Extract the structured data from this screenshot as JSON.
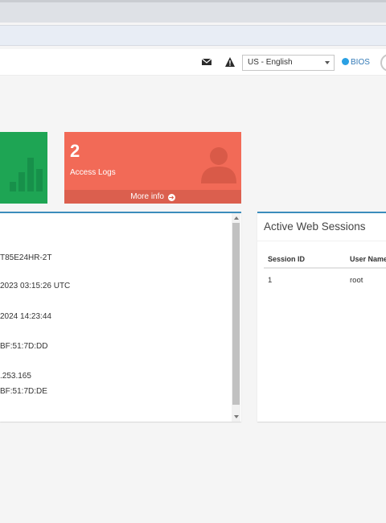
{
  "header": {
    "language_select": {
      "value": "US - English"
    },
    "bios_link": "BIOS",
    "icons": [
      "envelope-icon",
      "warning-icon",
      "globe-icon"
    ]
  },
  "tiles": {
    "green": {
      "icon": "bar-chart-icon",
      "color": "#1ea554"
    },
    "access_logs": {
      "count": "2",
      "label": "Access Logs",
      "more_info": "More info",
      "icon": "user-silhouette-icon",
      "color": "#f26a57"
    }
  },
  "info_panel": {
    "values": [
      "T85E24HR-2T",
      "2023 03:15:26 UTC",
      "2024 14:23:44",
      "BF:51:7D:DD",
      ".253.165",
      "BF:51:7D:DE"
    ]
  },
  "sessions": {
    "title": "Active Web Sessions",
    "columns": [
      "Session ID",
      "User Name"
    ],
    "rows": [
      {
        "session_id": "1",
        "user_name": "root"
      }
    ]
  },
  "colors": {
    "accent_border": "#3c8dbc",
    "page_bg": "#f5f5f5"
  }
}
